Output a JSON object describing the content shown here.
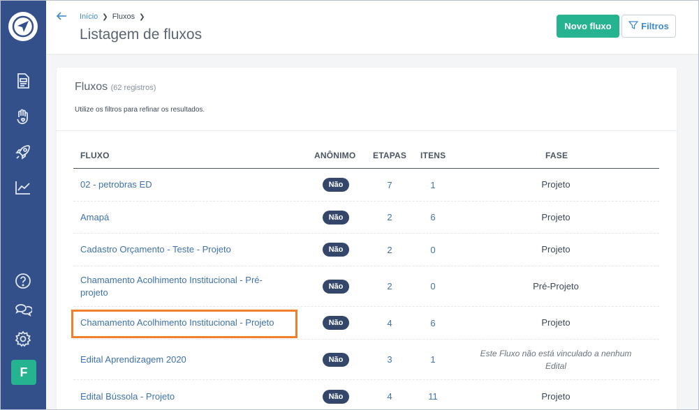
{
  "sidebar": {
    "logo": "send-logo-icon",
    "nav_items": [
      {
        "icon": "document-icon"
      },
      {
        "icon": "hand-heart-icon"
      },
      {
        "icon": "rocket-icon"
      },
      {
        "icon": "chart-line-icon"
      }
    ],
    "bottom_items": [
      {
        "icon": "help-icon"
      },
      {
        "icon": "chat-icon"
      },
      {
        "icon": "gear-icon"
      }
    ],
    "user_initial": "F"
  },
  "header": {
    "breadcrumb": [
      "Início",
      "Fluxos"
    ],
    "title": "Listagem de fluxos",
    "new_button": "Novo fluxo",
    "filter_button": "Filtros"
  },
  "card": {
    "title": "Fluxos",
    "count": "(62 registros)",
    "subtitle": "Utilize os filtros para refinar os resultados."
  },
  "table": {
    "columns": [
      "FLUXO",
      "ANÔNIMO",
      "ETAPAS",
      "ITENS",
      "FASE"
    ],
    "rows": [
      {
        "name": "02 - petrobras ED",
        "anon": "Não",
        "etapas": "7",
        "itens": "1",
        "fase": "Projeto"
      },
      {
        "name": "Amapá",
        "anon": "Não",
        "etapas": "2",
        "itens": "6",
        "fase": "Projeto"
      },
      {
        "name": "Cadastro Orçamento - Teste - Projeto",
        "anon": "Não",
        "etapas": "2",
        "itens": "0",
        "fase": "Projeto"
      },
      {
        "name": "Chamamento Acolhimento Institucional - Pré-projeto",
        "anon": "Não",
        "etapas": "2",
        "itens": "0",
        "fase": "Pré-Projeto"
      },
      {
        "name": "Chamamento Acolhimento Institucional - Projeto",
        "anon": "Não",
        "etapas": "4",
        "itens": "6",
        "fase": "Projeto"
      },
      {
        "name": "Edital Aprendizagem 2020",
        "anon": "Não",
        "etapas": "3",
        "itens": "1",
        "fase": "Este Fluxo não está vinculado a nenhum Edital"
      },
      {
        "name": "Edital Bússola - Projeto",
        "anon": "Não",
        "etapas": "4",
        "itens": "11",
        "fase": "Projeto"
      }
    ]
  },
  "colors": {
    "sidebar": "#33508a",
    "accent_green": "#25b48f",
    "link_blue": "#3d72b0",
    "highlight": "#f0802b"
  }
}
